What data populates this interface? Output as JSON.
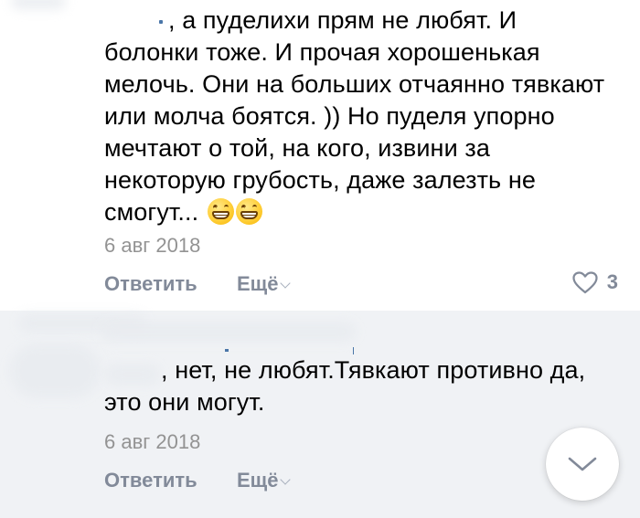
{
  "comments": [
    {
      "text_lines": [
        ", а пуделихи прям не любят. И",
        "болонки тоже. И прочая хорошенькая",
        "мелочь. Они на больших отчаянно тявкают",
        "или молча боятся. )) Но пуделя упорно",
        "мечтают о той, на кого, извини за",
        "некоторую грубость, даже залезть не",
        "смогут..."
      ],
      "emojis": [
        "grinning-face",
        "grinning-face"
      ],
      "date": "6 авг 2018",
      "reply_label": "Ответить",
      "more_label": "Ещё",
      "likes": "3"
    },
    {
      "text_lines": [
        ", нет, не любят.Тявкают противно да,",
        "это они могут."
      ],
      "date": "6 авг 2018",
      "reply_label": "Ответить",
      "more_label": "Ещё"
    }
  ],
  "colors": {
    "link": "#4a76a8",
    "muted": "#828a99",
    "date": "#939393",
    "highlight_bg": "#f0f2f5"
  },
  "icons": {
    "like": "heart-outline-icon",
    "scroll": "chevron-down-icon"
  }
}
